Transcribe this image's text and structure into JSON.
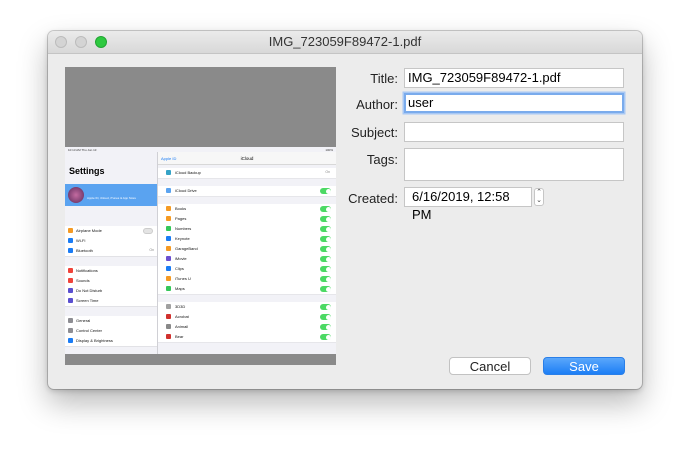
{
  "window": {
    "title": "IMG_723059F89472-1.pdf"
  },
  "form": {
    "title_label": "Title:",
    "title_value": "IMG_723059F89472-1.pdf",
    "author_label": "Author:",
    "author_value": "user",
    "subject_label": "Subject:",
    "subject_value": "",
    "tags_label": "Tags:",
    "tags_value": "",
    "created_label": "Created:",
    "created_value": "6/16/2019, 12:58 PM"
  },
  "buttons": {
    "cancel": "Cancel",
    "save": "Save"
  },
  "colors": {
    "accent": "#1c7ef5",
    "focus_ring": "#7aabec",
    "toggle_on": "#4cd964"
  },
  "preview": {
    "status_time": "10:13 AM  Thu Jun 13",
    "status_battery": "100%",
    "left_title": "Settings",
    "profile_sub": "Apple ID, iCloud, iTunes & App Store",
    "left_rows": [
      {
        "label": "Airplane Mode",
        "value": "",
        "toggle": true,
        "color": "#f59a23"
      },
      {
        "label": "Wi-Fi",
        "value": "",
        "toggle": false,
        "color": "#1a7cf5"
      },
      {
        "label": "Bluetooth",
        "value": "On",
        "toggle": false,
        "color": "#1a7cf5"
      },
      {
        "label": "Notifications",
        "value": "",
        "toggle": false,
        "color": "#f0433a"
      },
      {
        "label": "Sounds",
        "value": "",
        "toggle": false,
        "color": "#f0433a"
      },
      {
        "label": "Do Not Disturb",
        "value": "",
        "toggle": false,
        "color": "#5a4fd0"
      },
      {
        "label": "Screen Time",
        "value": "",
        "toggle": false,
        "color": "#5a4fd0"
      },
      {
        "label": "General",
        "value": "",
        "toggle": false,
        "color": "#8e8e93"
      },
      {
        "label": "Control Center",
        "value": "",
        "toggle": false,
        "color": "#8e8e93"
      },
      {
        "label": "Display & Brightness",
        "value": "",
        "toggle": false,
        "color": "#1a7cf5"
      }
    ],
    "right_back": "Apple ID",
    "right_title": "iCloud",
    "right_rows": [
      {
        "label": "iCloud Backup",
        "value": "On",
        "toggle": false,
        "color": "#35a3c7"
      },
      {
        "label": "iCloud Drive",
        "value": "",
        "toggle": true,
        "color": "#5aa3f0"
      },
      {
        "label": "Books",
        "value": "",
        "toggle": true,
        "color": "#f59a23"
      },
      {
        "label": "Pages",
        "value": "",
        "toggle": true,
        "color": "#f59a23"
      },
      {
        "label": "Numbers",
        "value": "",
        "toggle": true,
        "color": "#34c759"
      },
      {
        "label": "Keynote",
        "value": "",
        "toggle": true,
        "color": "#1a7cf5"
      },
      {
        "label": "GarageBand",
        "value": "",
        "toggle": true,
        "color": "#f59a23"
      },
      {
        "label": "iMovie",
        "value": "",
        "toggle": true,
        "color": "#6b4fd0"
      },
      {
        "label": "Clips",
        "value": "",
        "toggle": true,
        "color": "#1a7cf5"
      },
      {
        "label": "iTunes U",
        "value": "",
        "toggle": true,
        "color": "#f59a23"
      },
      {
        "label": "Maps",
        "value": "",
        "toggle": true,
        "color": "#34c759"
      },
      {
        "label": "3D3D",
        "value": "",
        "toggle": true,
        "color": "#a0a0a0"
      },
      {
        "label": "Acrobat",
        "value": "",
        "toggle": true,
        "color": "#d0312d"
      },
      {
        "label": "Animail",
        "value": "",
        "toggle": true,
        "color": "#888"
      },
      {
        "label": "Bear",
        "value": "",
        "toggle": true,
        "color": "#d0312d"
      }
    ]
  }
}
